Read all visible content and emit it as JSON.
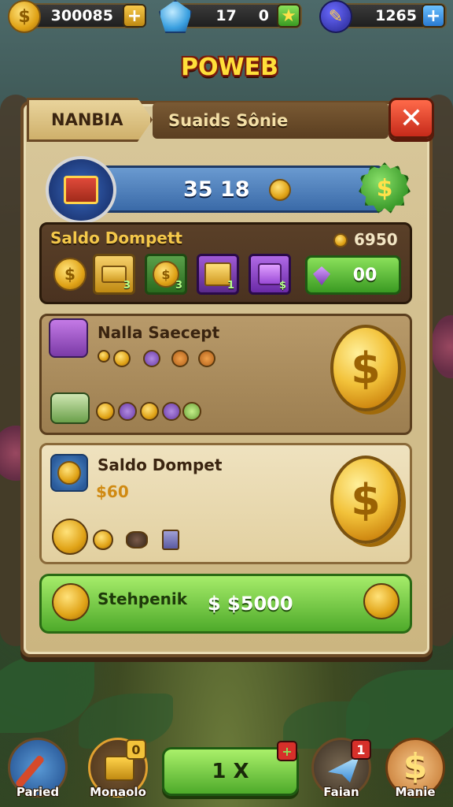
{
  "topbar": {
    "coins": "300085",
    "gems": "17",
    "gems_extra": "0",
    "keys": "1265"
  },
  "logo": {
    "text": "POWEB"
  },
  "panel": {
    "tab_label": "NANBIA",
    "title": "Suaids Sônie",
    "close_label": "✕"
  },
  "balance": {
    "value": "35 18",
    "dollar_symbol": "$"
  },
  "wallet": {
    "title": "Saldo Dompett",
    "count": "6950",
    "slots": [
      {
        "num": ""
      },
      {
        "num": "3"
      },
      {
        "num": "3"
      },
      {
        "num": "1"
      },
      {
        "num": "$"
      }
    ],
    "button_value": "00"
  },
  "section_nalla": {
    "title": "Nalla Saecept",
    "big_symbol": "$"
  },
  "section_dompet": {
    "title": "Saldo Dompet",
    "value": "$60",
    "big_symbol": "$"
  },
  "total": {
    "label": "Stehpenik",
    "value": "$ $5000"
  },
  "nav": {
    "left1": "Paried",
    "left2": "Monaolo",
    "center": "1 X",
    "right1": "Faian",
    "right2": "Manie",
    "left2_badge": "0",
    "center_badge": "+",
    "right1_badge": "1"
  },
  "colors": {
    "gold": "#f2c23a",
    "panel": "#d8c79a",
    "green": "#4eaa2a",
    "blue": "#3a6aa8"
  }
}
